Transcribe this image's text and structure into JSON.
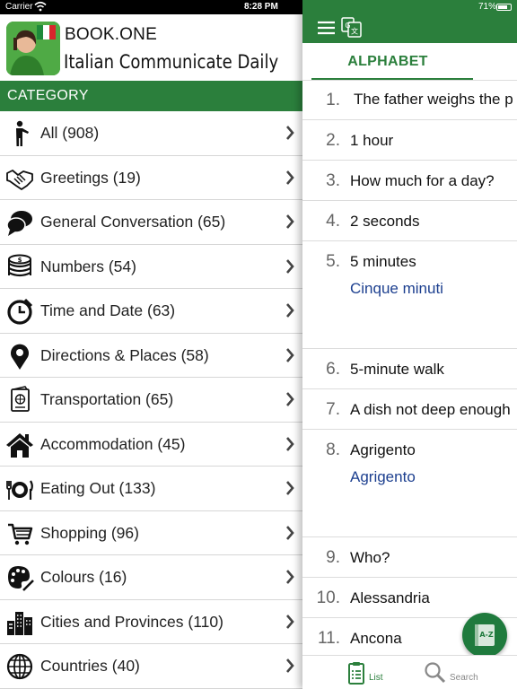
{
  "status_bar": {
    "carrier": "Carrier",
    "time": "8:28 PM",
    "battery": "71%"
  },
  "app": {
    "brand": "BOOK.ONE",
    "subtitle": "Italian Communicate Daily"
  },
  "category_header": "CATEGORY",
  "categories": [
    {
      "label": "All (908)",
      "icon": "person-pointing-icon"
    },
    {
      "label": "Greetings (19)",
      "icon": "handshake-icon"
    },
    {
      "label": "General Conversation (65)",
      "icon": "chat-bubbles-icon"
    },
    {
      "label": "Numbers (54)",
      "icon": "coins-icon"
    },
    {
      "label": "Time and Date (63)",
      "icon": "clock-icon"
    },
    {
      "label": "Directions & Places (58)",
      "icon": "map-pin-icon"
    },
    {
      "label": "Transportation (65)",
      "icon": "passport-icon"
    },
    {
      "label": "Accommodation (45)",
      "icon": "house-icon"
    },
    {
      "label": "Eating Out (133)",
      "icon": "plate-cutlery-icon"
    },
    {
      "label": "Shopping (96)",
      "icon": "shopping-cart-icon"
    },
    {
      "label": "Colours (16)",
      "icon": "palette-icon"
    },
    {
      "label": "Cities and Provinces (110)",
      "icon": "city-buildings-icon"
    },
    {
      "label": "Countries (40)",
      "icon": "globe-icon"
    }
  ],
  "right_panel": {
    "tab_label": "ALPHABET",
    "phrases": [
      {
        "num": "1.",
        "text": "The father weighs the p",
        "translation": ""
      },
      {
        "num": "2.",
        "text": "1 hour",
        "translation": ""
      },
      {
        "num": "3.",
        "text": "How much for a day?",
        "translation": ""
      },
      {
        "num": "4.",
        "text": "2 seconds",
        "translation": ""
      },
      {
        "num": "5.",
        "text": "5 minutes",
        "translation": "Cinque minuti"
      },
      {
        "num": "6.",
        "text": "5-minute walk",
        "translation": ""
      },
      {
        "num": "7.",
        "text": "A dish not deep enough",
        "translation": ""
      },
      {
        "num": "8.",
        "text": "Agrigento",
        "translation": "Agrigento"
      },
      {
        "num": "9.",
        "text": "Who?",
        "translation": ""
      },
      {
        "num": "10.",
        "text": "Alessandria",
        "translation": ""
      },
      {
        "num": "11.",
        "text": "Ancona",
        "translation": ""
      }
    ],
    "fab_label": "A-Z",
    "bottom_tabs": {
      "list": "List",
      "search": "Search"
    }
  },
  "colors": {
    "brand_green": "#2b7f3c",
    "translation_blue": "#1c3f8f"
  }
}
